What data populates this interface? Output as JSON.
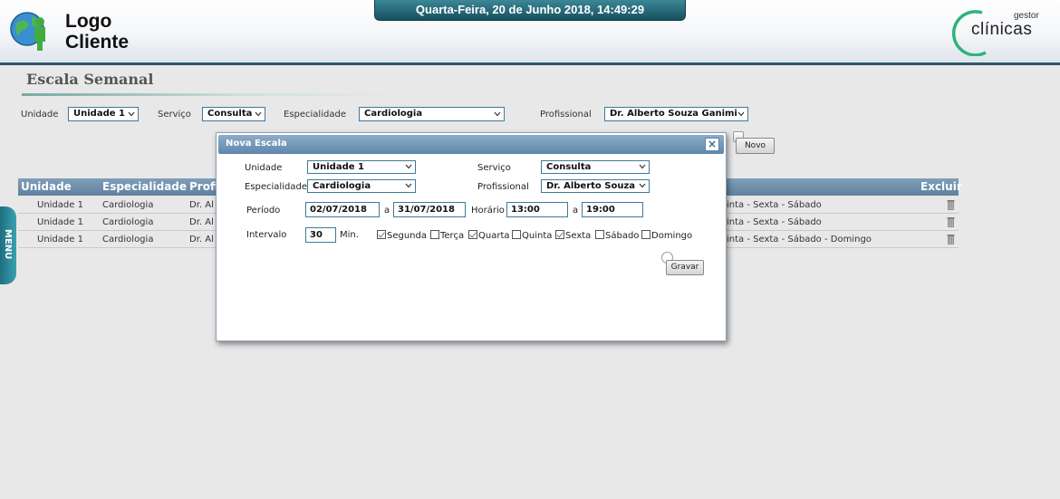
{
  "header": {
    "logo_line1": "Logo",
    "logo_line2": "Cliente",
    "datetime": "Quarta-Feira, 20 de Junho 2018, 14:49:29",
    "brand_small": "gestor",
    "brand_big": "clínicas"
  },
  "page": {
    "title": "Escala Semanal"
  },
  "filters": {
    "unidade_label": "Unidade",
    "unidade_value": "Unidade 1",
    "servico_label": "Serviço",
    "servico_value": "Consulta",
    "especialidade_label": "Especialidade",
    "especialidade_value": "Cardiologia",
    "profissional_label": "Profissional",
    "profissional_value": "Dr. Alberto Souza Ganimi",
    "novo_label": "Novo"
  },
  "table": {
    "headers": {
      "unidade": "Unidade",
      "especialidade": "Especialidade",
      "profissional": "Profi",
      "excluir": "Excluir"
    },
    "rows": [
      {
        "unidade": "Unidade 1",
        "especialidade": "Cardiologia",
        "profissional": "Dr. Al",
        "dias": "inta - Sexta - Sábado"
      },
      {
        "unidade": "Unidade 1",
        "especialidade": "Cardiologia",
        "profissional": "Dr. Al",
        "dias": "inta - Sexta - Sábado"
      },
      {
        "unidade": "Unidade 1",
        "especialidade": "Cardiologia",
        "profissional": "Dr. Al",
        "dias": "inta - Sexta - Sábado - Domingo"
      }
    ]
  },
  "menu_tab": {
    "label": "MENU"
  },
  "modal": {
    "title": "Nova Escala",
    "close_label": "×",
    "unidade_label": "Unidade",
    "unidade_value": "Unidade 1",
    "servico_label": "Serviço",
    "servico_value": "Consulta",
    "especialidade_label": "Especialidade",
    "especialidade_value": "Cardiologia",
    "profissional_label": "Profissional",
    "profissional_value": "Dr. Alberto Souza",
    "periodo_label": "Período",
    "periodo_inicio": "02/07/2018",
    "periodo_sep": "a",
    "periodo_fim": "31/07/2018",
    "horario_label": "Horário",
    "horario_inicio": "13:00",
    "horario_sep": "a",
    "horario_fim": "19:00",
    "intervalo_label": "Intervalo",
    "intervalo_value": "30",
    "intervalo_unit": "Min.",
    "days": [
      {
        "label": "Segunda",
        "checked": true
      },
      {
        "label": "Terça",
        "checked": false
      },
      {
        "label": "Quarta",
        "checked": true
      },
      {
        "label": "Quinta",
        "checked": false
      },
      {
        "label": "Sexta",
        "checked": true
      },
      {
        "label": "Sábado",
        "checked": false
      },
      {
        "label": "Domingo",
        "checked": false
      }
    ],
    "gravar_label": "Gravar"
  },
  "colors": {
    "header_accent": "#2c5868",
    "table_header": "#6f91ad",
    "field_border": "#3d7b98",
    "brand_ring": "#2fb37a"
  }
}
